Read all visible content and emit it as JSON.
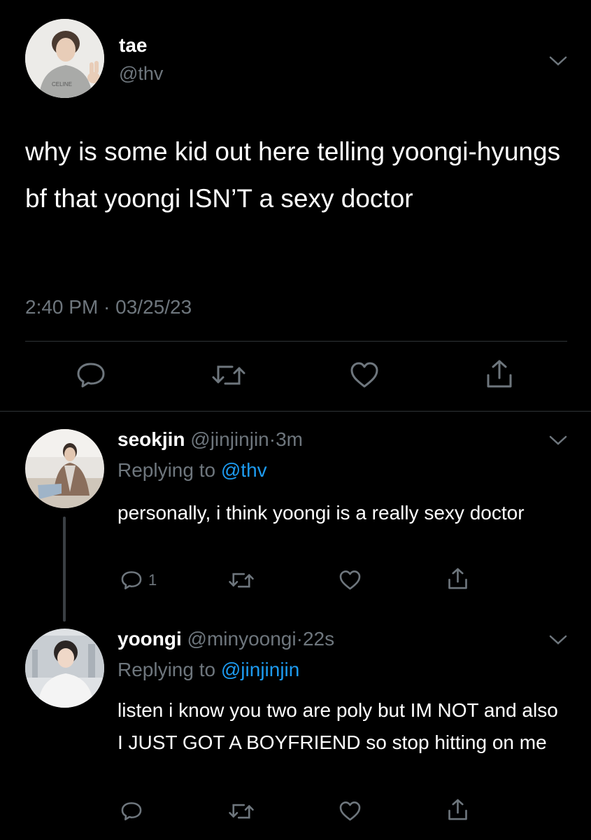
{
  "main_tweet": {
    "name": "tae",
    "handle": "@thv",
    "avatar_text": "CELINE",
    "text": "why is some kid out here telling yoongi-hyungs bf that yoongi ISN’T a sexy doctor",
    "timestamp": "2:40 PM · 03/25/23",
    "actions": {
      "reply_icon": "reply-bubble-icon",
      "retweet_icon": "retweet-icon",
      "like_icon": "heart-icon",
      "share_icon": "share-icon"
    }
  },
  "replies": [
    {
      "name": "seokjin",
      "handle": "@jinjinjin",
      "time": "3m",
      "replying_to_label": "Replying to",
      "replying_to_handle": "@thv",
      "text": "personally, i think yoongi is a really sexy doctor",
      "reply_count": "1"
    },
    {
      "name": "yoongi",
      "handle": "@minyoongi",
      "time": "22s",
      "replying_to_label": "Replying to",
      "replying_to_handle": "@jinjinjin",
      "text": "listen i know you two are poly but IM NOT and also I JUST GOT A BOYFRIEND so stop hitting on me",
      "reply_count": ""
    }
  ],
  "colors": {
    "background": "#000000",
    "text": "#ffffff",
    "muted": "#6e767d",
    "link": "#1d9bf0",
    "divider": "#2f3336"
  }
}
